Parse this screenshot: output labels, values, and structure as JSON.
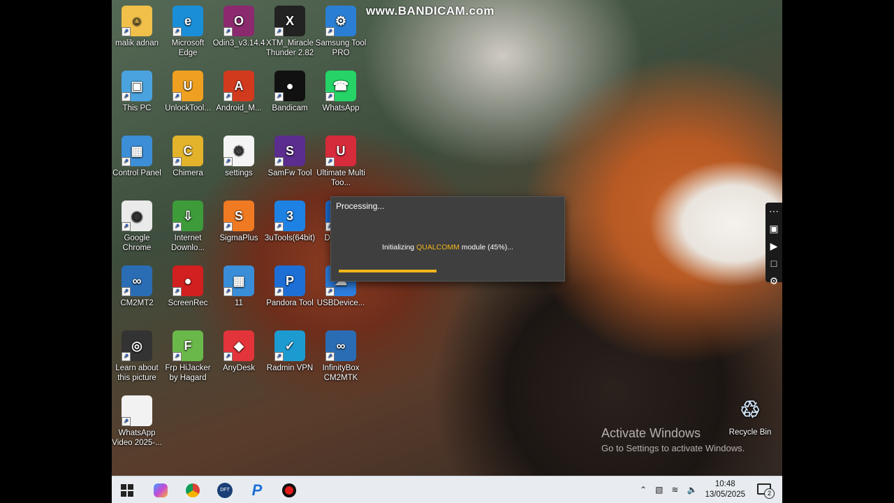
{
  "watermark": "www.BANDICAM.com",
  "desktop": {
    "icons": [
      {
        "label": "malik adnan",
        "name": "user-folder-icon",
        "color": "#f0c04a",
        "glyph": "☺"
      },
      {
        "label": "Microsoft Edge",
        "name": "edge-icon",
        "color": "#1a8fd8",
        "glyph": "e"
      },
      {
        "label": "Odin3_v3.14.4",
        "name": "odin-icon",
        "color": "#8b2a6e",
        "glyph": "O"
      },
      {
        "label": "XTM_Miracle Thunder 2.82",
        "name": "xtm-miracle-icon",
        "color": "#222222",
        "glyph": "X"
      },
      {
        "label": "Samsung Tool PRO",
        "name": "samsung-tool-icon",
        "color": "#2a7fd4",
        "glyph": "⚙"
      },
      {
        "label": "This PC",
        "name": "this-pc-icon",
        "color": "#4aa3df",
        "glyph": "▣"
      },
      {
        "label": "UnlockTool...",
        "name": "unlocktool-icon",
        "color": "#f0a020",
        "glyph": "U"
      },
      {
        "label": "Android_M...",
        "name": "android-multitool-icon",
        "color": "#d23a1e",
        "glyph": "A"
      },
      {
        "label": "Bandicam",
        "name": "bandicam-icon",
        "color": "#111111",
        "glyph": "●"
      },
      {
        "label": "WhatsApp",
        "name": "whatsapp-icon",
        "color": "#25d366",
        "glyph": "☎"
      },
      {
        "label": "Control Panel",
        "name": "control-panel-icon",
        "color": "#3c8ed6",
        "glyph": "▦"
      },
      {
        "label": "Chimera",
        "name": "chimera-icon",
        "color": "#e2b32b",
        "glyph": "C"
      },
      {
        "label": "settings",
        "name": "settings-file-icon",
        "color": "#f4f4f4",
        "glyph": "⚙"
      },
      {
        "label": "SamFw Tool",
        "name": "samfw-tool-icon",
        "color": "#5b2d8e",
        "glyph": "S"
      },
      {
        "label": "Ultimate Multi Too...",
        "name": "ultimate-multi-tool-icon",
        "color": "#d62b3a",
        "glyph": "U"
      },
      {
        "label": "Google Chrome",
        "name": "chrome-icon",
        "color": "#eaeaea",
        "glyph": "◉"
      },
      {
        "label": "Internet Downlo...",
        "name": "internet-download-manager-icon",
        "color": "#3d9b3a",
        "glyph": "⇩"
      },
      {
        "label": "SigmaPlus",
        "name": "sigmaplus-icon",
        "color": "#f07a22",
        "glyph": "S"
      },
      {
        "label": "3uTools(64bit)",
        "name": "3utools-icon",
        "color": "#1e82e4",
        "glyph": "3"
      },
      {
        "label": "DFTPRO",
        "name": "dftpro-icon",
        "color": "#1b6bd0",
        "glyph": "D"
      },
      {
        "label": "CM2MT2",
        "name": "cm2mt2-icon",
        "color": "#2a6db5",
        "glyph": "∞"
      },
      {
        "label": "ScreenRec",
        "name": "screenrec-icon",
        "color": "#d21f1f",
        "glyph": "●"
      },
      {
        "label": "11",
        "name": "folder-11-icon",
        "color": "#3a8ed8",
        "glyph": "▦"
      },
      {
        "label": "Pandora Tool",
        "name": "pandora-tool-icon",
        "color": "#1d6fd6",
        "glyph": "P"
      },
      {
        "label": "USBDevice...",
        "name": "usbdevice-icon",
        "color": "#2d7fe0",
        "glyph": "☁"
      },
      {
        "label": "Learn about this picture",
        "name": "learn-picture-icon",
        "color": "#333333",
        "glyph": "◎"
      },
      {
        "label": "Frp HiJacker by Hagard",
        "name": "frp-hijacker-icon",
        "color": "#6bb84a",
        "glyph": "F"
      },
      {
        "label": "AnyDesk",
        "name": "anydesk-icon",
        "color": "#e2343a",
        "glyph": "◆"
      },
      {
        "label": "Radmin VPN",
        "name": "radmin-vpn-icon",
        "color": "#1c9bd1",
        "glyph": "✓"
      },
      {
        "label": "InfinityBox CM2MTK",
        "name": "infinitybox-cm2mtk-icon",
        "color": "#2a6db5",
        "glyph": "∞"
      },
      {
        "label": "WhatsApp Video 2025-...",
        "name": "whatsapp-video-file-icon",
        "color": "#f2f2f2",
        "glyph": ""
      }
    ],
    "recycle_bin": {
      "label": "Recycle Bin",
      "glyph": "♲"
    }
  },
  "dialog": {
    "title": "Processing...",
    "message_prefix": "Initializing ",
    "message_highlight": "QUALCOMM",
    "message_suffix": " module (45%)...",
    "progress": 0.45,
    "accent_color": "#f2b51a"
  },
  "side_toolbar": {
    "items": [
      {
        "name": "toolbar-menu-icon",
        "glyph": "⋯"
      },
      {
        "name": "camera-icon",
        "glyph": "▣"
      },
      {
        "name": "video-camera-icon",
        "glyph": "▶"
      },
      {
        "name": "window-icon",
        "glyph": "□"
      },
      {
        "name": "gear-icon",
        "glyph": "⚙"
      }
    ]
  },
  "activation": {
    "title": "Activate Windows",
    "subtitle": "Go to Settings to activate Windows."
  },
  "taskbar": {
    "time": "10:48",
    "date": "13/05/2025",
    "notification_count": "2"
  }
}
